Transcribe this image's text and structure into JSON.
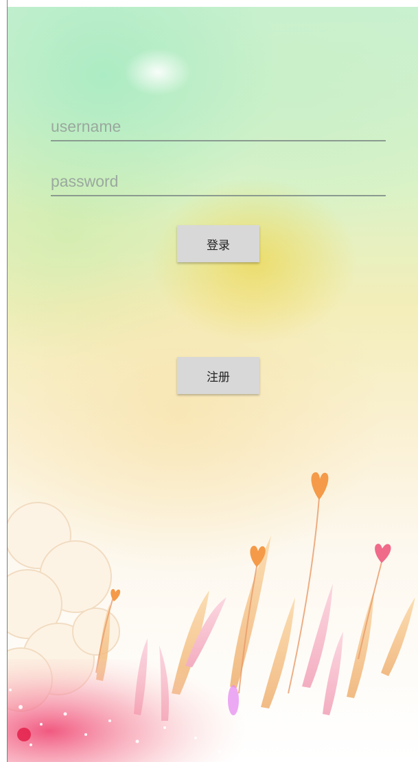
{
  "login_form": {
    "username_placeholder": "username",
    "password_placeholder": "password",
    "login_label": "登录",
    "register_label": "注册"
  },
  "background": {
    "theme": "pastel meadow with heart-shaped flowers",
    "colors": {
      "mint": "#c8f0d2",
      "yellow_glow": "#ecd650",
      "peach": "#f6c489",
      "pink": "#f06a8a",
      "orange_heart": "#f49a48"
    }
  }
}
